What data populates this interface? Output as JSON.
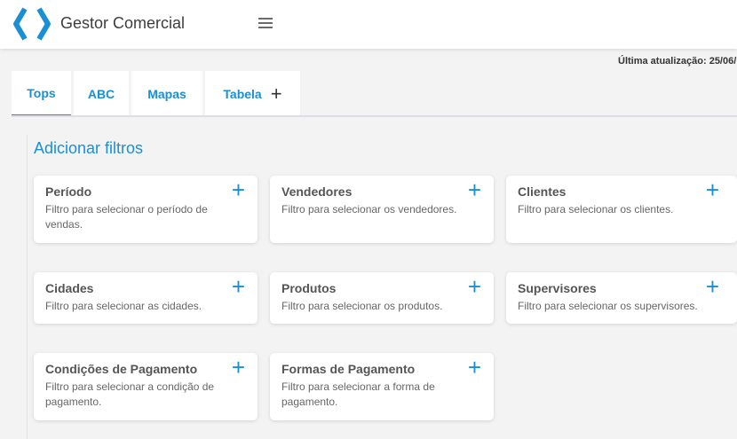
{
  "app": {
    "title": "Gestor Comercial"
  },
  "header": {
    "last_update": "Última atualização: 25/06/"
  },
  "tabs": [
    {
      "label": "Tops"
    },
    {
      "label": "ABC"
    },
    {
      "label": "Mapas"
    },
    {
      "label": "Tabela"
    }
  ],
  "filters": {
    "title": "Adicionar filtros",
    "cards": [
      {
        "title": "Período",
        "desc": "Filtro para selecionar o período de vendas."
      },
      {
        "title": "Vendedores",
        "desc": "Filtro para selecionar os vendedores."
      },
      {
        "title": "Clientes",
        "desc": "Filtro para selecionar os clientes."
      },
      {
        "title": "Cidades",
        "desc": "Filtro para selecionar as cidades."
      },
      {
        "title": "Produtos",
        "desc": "Filtro para selecionar os produtos."
      },
      {
        "title": "Supervisores",
        "desc": "Filtro para selecionar os supervisores."
      },
      {
        "title": "Condições de Pagamento",
        "desc": "Filtro para selecionar a condição de pagamento."
      },
      {
        "title": "Formas de Pagamento",
        "desc": "Filtro para selecionar a forma de pagamento."
      }
    ]
  },
  "colors": {
    "accent": "#1a8fd6",
    "background": "#f3f3f3",
    "card": "#ffffff"
  },
  "icons": {
    "logo": "code-brackets-icon",
    "menu": "hamburger-icon",
    "add": "plus-icon"
  }
}
